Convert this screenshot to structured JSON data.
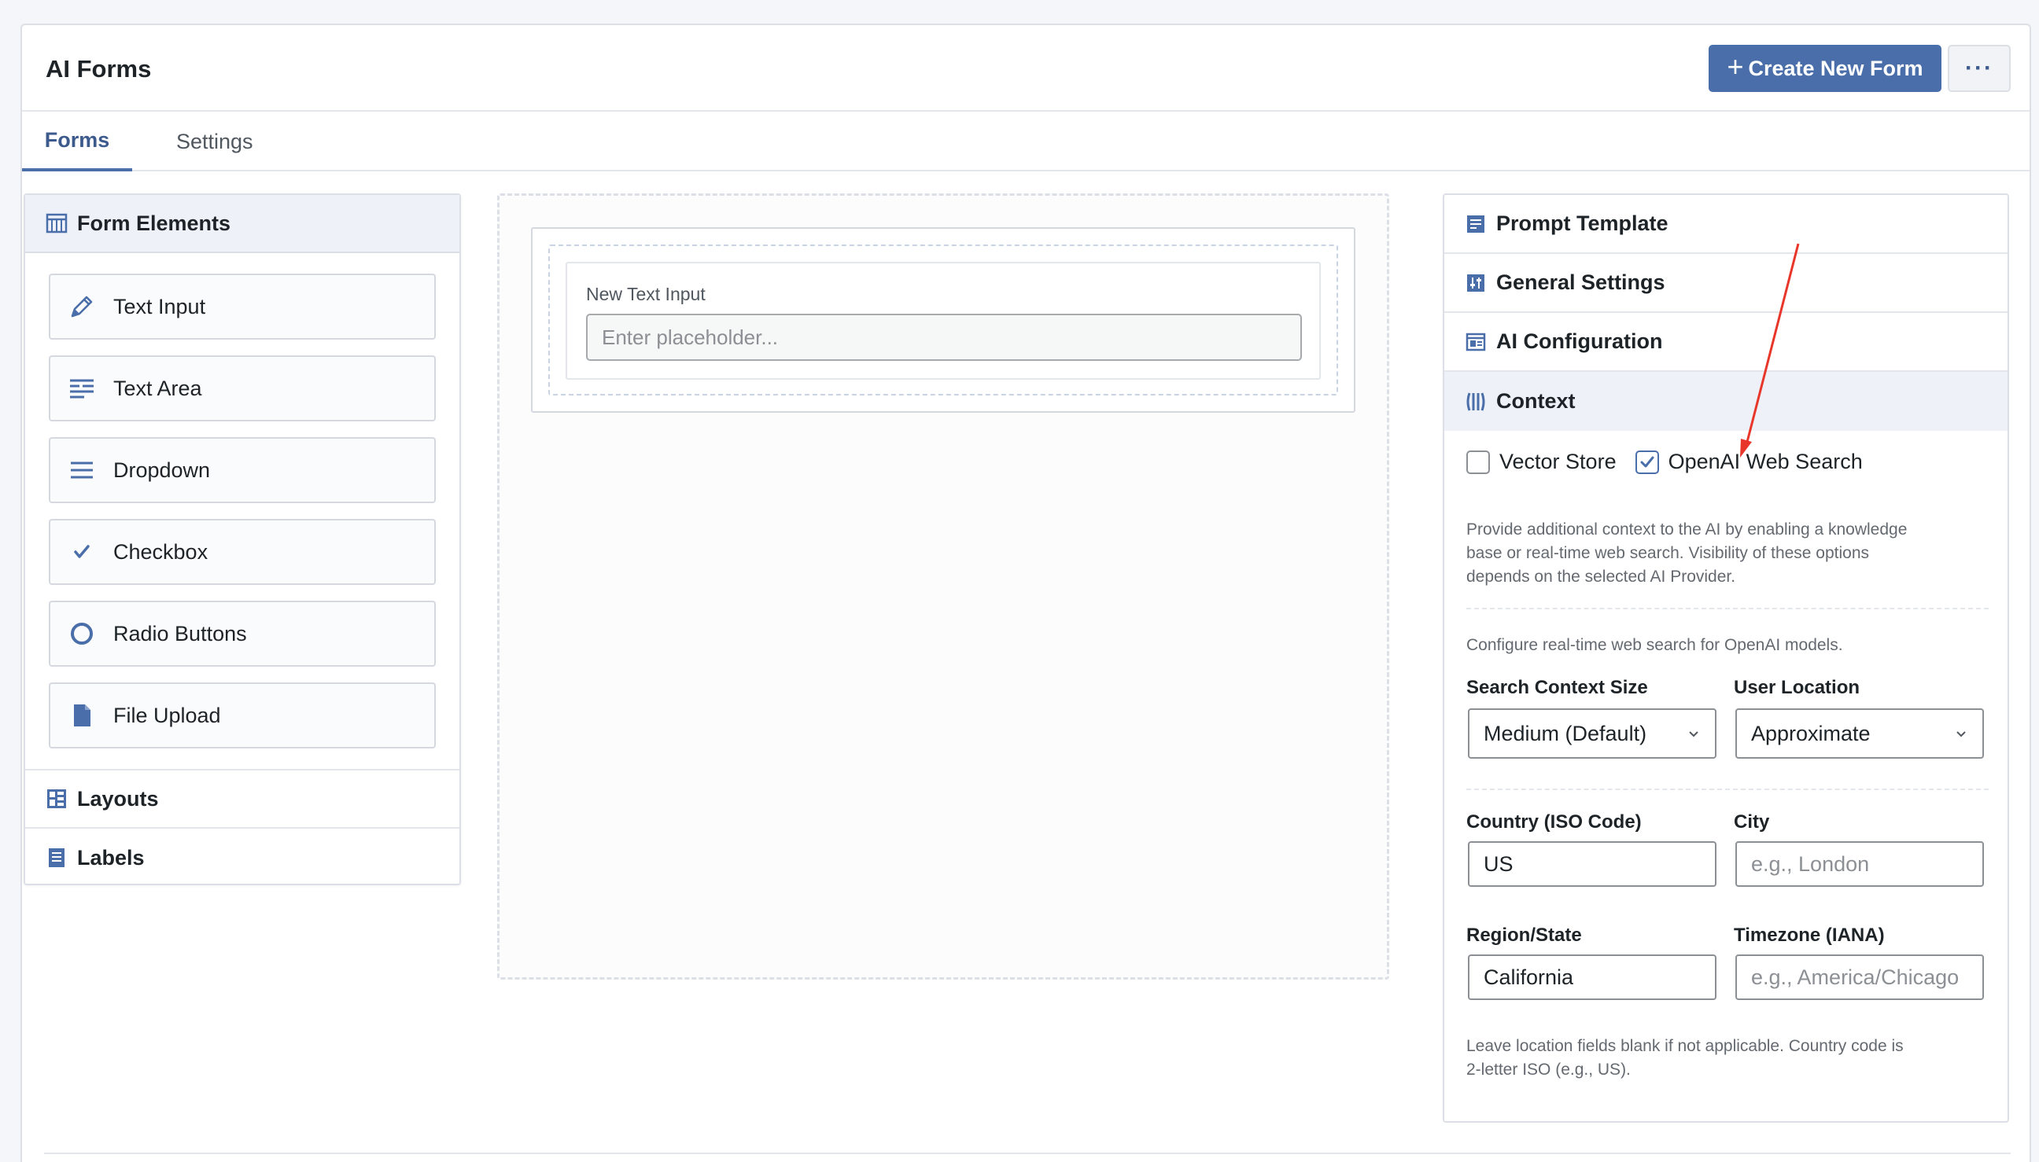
{
  "header": {
    "title": "AI Forms",
    "create_label": "Create New Form",
    "more_label": "···"
  },
  "tabs": [
    {
      "label": "Forms",
      "active": true
    },
    {
      "label": "Settings",
      "active": false
    }
  ],
  "left_panel": {
    "title": "Form Elements",
    "elements": [
      {
        "label": "Text Input",
        "icon": "pencil-icon"
      },
      {
        "label": "Text Area",
        "icon": "text-lines-icon"
      },
      {
        "label": "Dropdown",
        "icon": "menu-lines-icon"
      },
      {
        "label": "Checkbox",
        "icon": "checkmark-icon"
      },
      {
        "label": "Radio Buttons",
        "icon": "radio-circle-icon"
      },
      {
        "label": "File Upload",
        "icon": "file-icon"
      }
    ],
    "sections": [
      {
        "label": "Layouts",
        "icon": "layout-grid-icon"
      },
      {
        "label": "Labels",
        "icon": "label-doc-icon"
      }
    ]
  },
  "canvas": {
    "field_label": "New Text Input",
    "field_placeholder": "Enter placeholder..."
  },
  "right_panel": {
    "sections": [
      {
        "label": "Prompt Template",
        "icon": "prompt-doc-icon"
      },
      {
        "label": "General Settings",
        "icon": "settings-sliders-icon"
      },
      {
        "label": "AI Configuration",
        "icon": "ai-config-icon"
      },
      {
        "label": "Context",
        "icon": "context-columns-icon",
        "active": true
      }
    ],
    "context": {
      "vector_store": {
        "label": "Vector Store",
        "checked": false
      },
      "web_search": {
        "label": "OpenAI Web Search",
        "checked": true
      },
      "help_line1": "Provide additional context to the AI by enabling a knowledge",
      "help_line2": "base or real-time web search. Visibility of these options",
      "help_line3": "depends on the selected AI Provider.",
      "config_text": "Configure real-time web search for OpenAI models.",
      "search_context_label": "Search Context Size",
      "search_context_value": "Medium (Default)",
      "user_location_label": "User Location",
      "user_location_value": "Approximate",
      "country_label": "Country (ISO Code)",
      "country_value": "US",
      "city_label": "City",
      "city_placeholder": "e.g., London",
      "region_label": "Region/State",
      "region_value": "California",
      "timezone_label": "Timezone (IANA)",
      "timezone_placeholder": "e.g., America/Chicago",
      "footer_line1": "Leave location fields blank if not applicable. Country code is",
      "footer_line2": "2-letter ISO (e.g., US)."
    }
  },
  "colors": {
    "accent": "#4a6ea9",
    "active_section_bg": "#eef2f8",
    "annotation_arrow": "#e8372a"
  }
}
